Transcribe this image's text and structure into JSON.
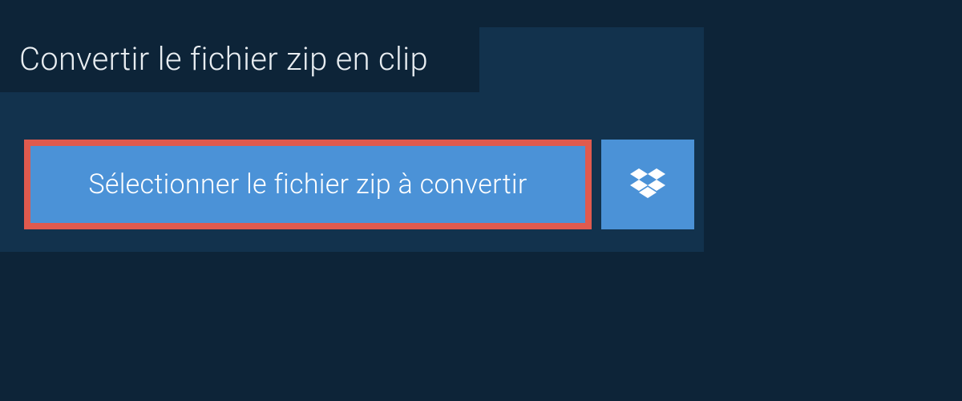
{
  "header": {
    "title": "Convertir le fichier zip en clip"
  },
  "actions": {
    "select_label": "Sélectionner le fichier zip à convertir"
  }
}
